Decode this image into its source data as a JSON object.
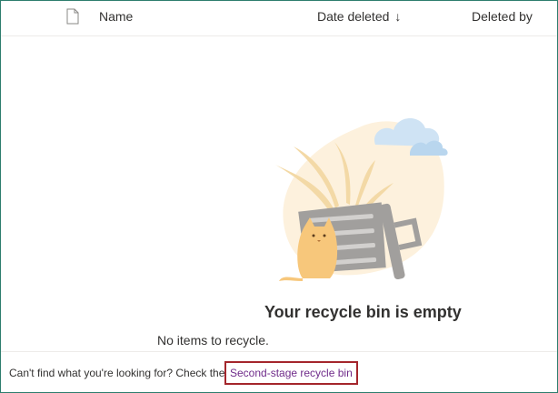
{
  "header": {
    "file_icon": "document-icon",
    "name_label": "Name",
    "date_label": "Date deleted",
    "sort_arrow": "↓",
    "deleted_by_label": "Deleted by"
  },
  "empty_state": {
    "illustration": "empty-trash-cat-illustration",
    "title": "Your recycle bin is empty",
    "subtitle": "No items to recycle."
  },
  "footer": {
    "text": "Can't find what you're looking for? Check the",
    "link_label": "Second-stage recycle bin"
  },
  "colors": {
    "link": "#6f2b8a",
    "link_border": "#a4262c",
    "frame_border": "#2e7d6e"
  }
}
